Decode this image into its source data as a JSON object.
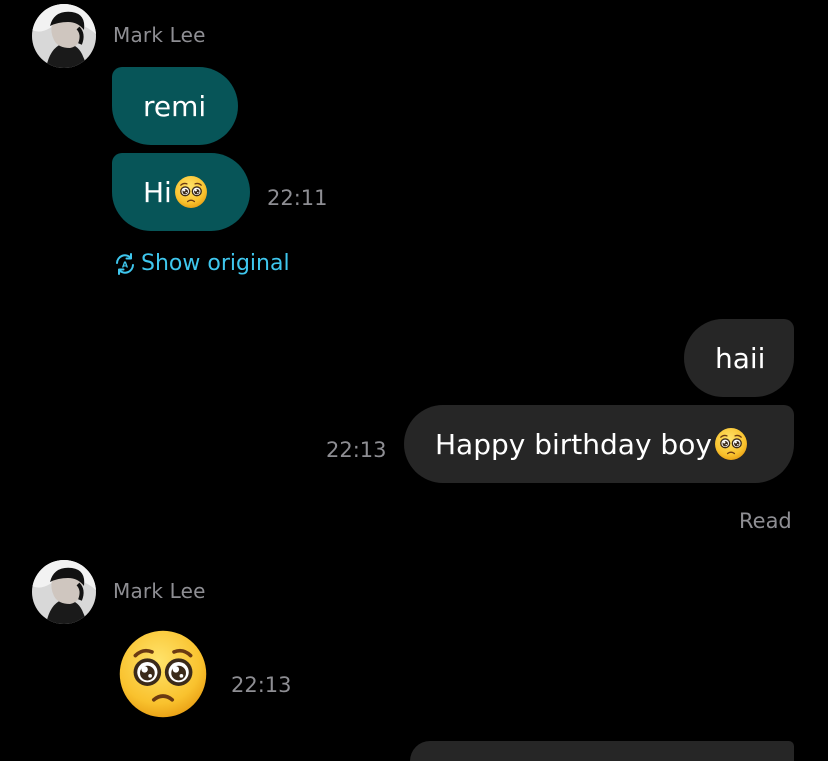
{
  "messages": [
    {
      "sender": "Mark Lee",
      "direction": "incoming",
      "bubbles": [
        {
          "text": "remi"
        },
        {
          "text": "Hi",
          "emoji": "pleading-face",
          "time": "22:11"
        }
      ],
      "translate_link": "Show original"
    },
    {
      "direction": "outgoing",
      "bubbles": [
        {
          "text": "haii"
        },
        {
          "text": "Happy birthday boy",
          "emoji": "pleading-face",
          "time": "22:13"
        }
      ],
      "status": "Read"
    },
    {
      "sender": "Mark Lee",
      "direction": "incoming",
      "bubbles": [
        {
          "emoji": "pleading-face",
          "time": "22:13"
        }
      ]
    }
  ],
  "colors": {
    "background": "#000000",
    "incoming_bubble": "#075558",
    "outgoing_bubble": "#262626",
    "link": "#3fc7ee",
    "meta_text": "#8e8e93"
  },
  "icons": {
    "translate": "translate-icon",
    "avatar": "avatar-photo"
  }
}
